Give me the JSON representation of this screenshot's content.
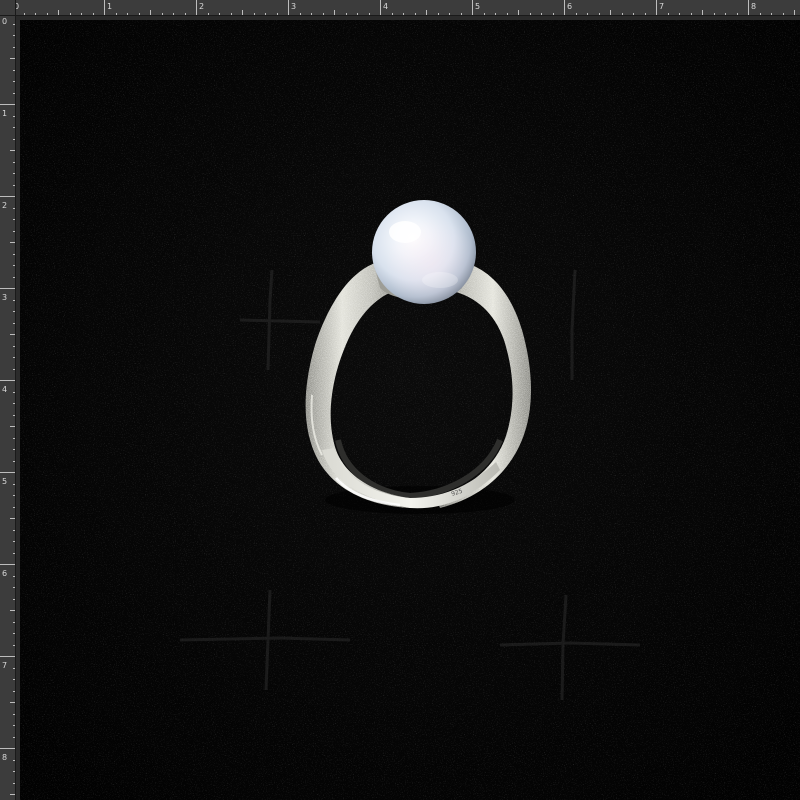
{
  "rulers": {
    "top_labels": [
      "0",
      "1",
      "2",
      "3",
      "4",
      "5",
      "6",
      "7",
      "8"
    ],
    "left_labels": [
      "0",
      "1",
      "2",
      "3",
      "4",
      "5",
      "6",
      "7",
      "8"
    ]
  },
  "photo": {
    "subject": "pearl-ring",
    "hallmark_text": "925",
    "colors": {
      "background": "#050505",
      "velvet_seam": "#2a2a2a",
      "silver": "#cfcfc8",
      "pearl": "#e9eef5"
    }
  }
}
